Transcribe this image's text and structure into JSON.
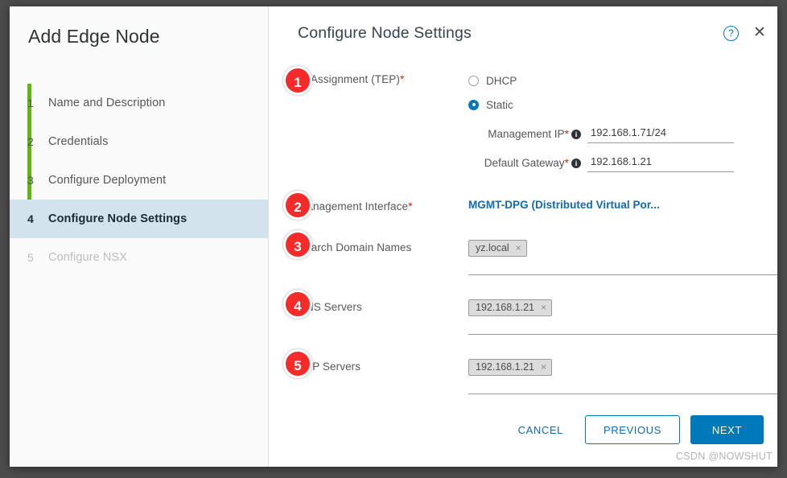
{
  "colors": {
    "accent_blue": "#0079b8",
    "link_blue": "#0f6ab4",
    "badge_red": "#f42b28",
    "progress_green": "#60b515",
    "active_step_bg": "#d2e3ec",
    "required_red": "#e02200"
  },
  "sidebar": {
    "title": "Add Edge Node",
    "steps": [
      {
        "num": "1",
        "label": "Name and Description",
        "state": "complete"
      },
      {
        "num": "2",
        "label": "Credentials",
        "state": "complete"
      },
      {
        "num": "3",
        "label": "Configure Deployment",
        "state": "complete"
      },
      {
        "num": "4",
        "label": "Configure Node Settings",
        "state": "active"
      },
      {
        "num": "5",
        "label": "Configure NSX",
        "state": "disabled"
      }
    ]
  },
  "header": {
    "title": "Configure Node Settings",
    "help_icon": "help-circle-icon",
    "help_glyph": "?",
    "close_icon": "close-icon",
    "close_glyph": "✕"
  },
  "form": {
    "ip_assignment": {
      "badge": "1",
      "label": "IP Assignment (TEP)",
      "required_mark": "*",
      "options": [
        {
          "label": "DHCP",
          "selected": false
        },
        {
          "label": "Static",
          "selected": true
        }
      ],
      "management_ip": {
        "label": "Management IP",
        "required_mark": "*",
        "info_glyph": "i",
        "value": "192.168.1.71/24"
      },
      "default_gateway": {
        "label": "Default Gateway",
        "required_mark": "*",
        "info_glyph": "i",
        "value": "192.168.1.21"
      }
    },
    "management_interface": {
      "badge": "2",
      "label": "Management Interface",
      "required_mark": "*",
      "value": "MGMT-DPG (Distributed Virtual Por..."
    },
    "search_domain_names": {
      "badge": "3",
      "label": "Search Domain Names",
      "chips": [
        {
          "text": "yz.local",
          "remove_glyph": "×"
        }
      ]
    },
    "dns_servers": {
      "badge": "4",
      "label": "DNS Servers",
      "chips": [
        {
          "text": "192.168.1.21",
          "remove_glyph": "×"
        }
      ]
    },
    "ntp_servers": {
      "badge": "5",
      "label": "NTP Servers",
      "chips": [
        {
          "text": "192.168.1.21",
          "remove_glyph": "×"
        }
      ]
    }
  },
  "footer": {
    "cancel_label": "CANCEL",
    "previous_label": "PREVIOUS",
    "next_label": "NEXT"
  },
  "watermark": "CSDN @NOWSHUT"
}
